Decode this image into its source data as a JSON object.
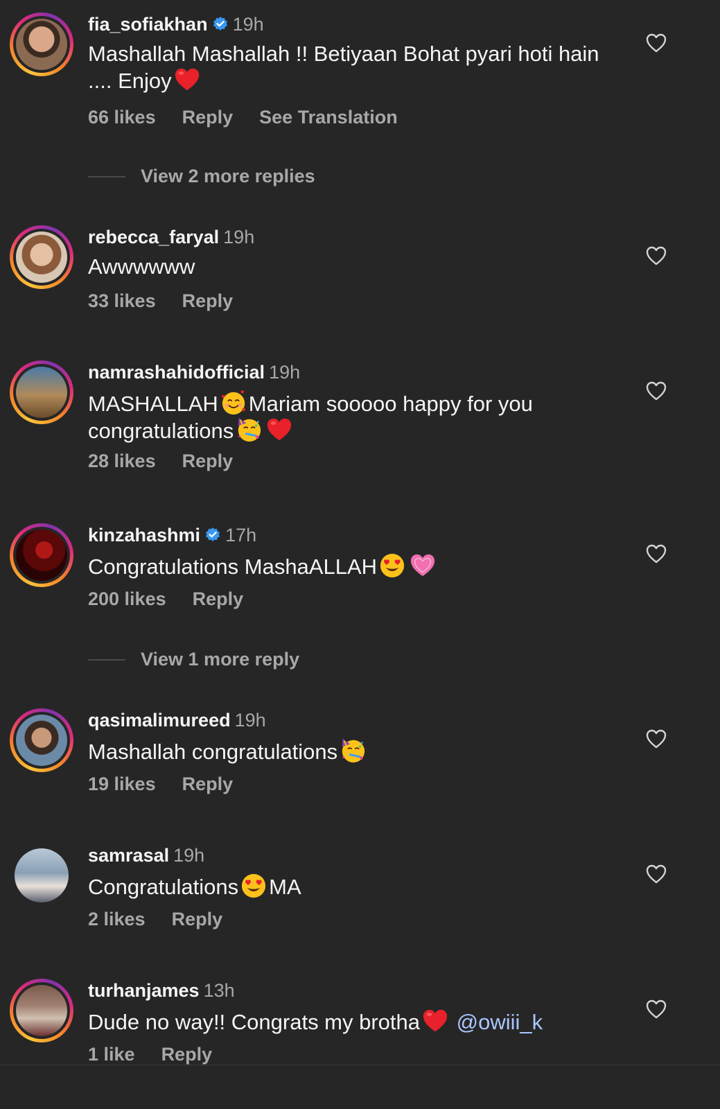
{
  "colors": {
    "background": "#262626",
    "text": "#f5f5f5",
    "muted": "#a8a8a8",
    "verified": "#3897f0",
    "mention": "#a9c7ff"
  },
  "comments": [
    {
      "username": "fia_sofiakhan",
      "verified": true,
      "time": "19h",
      "text": "Mashallah Mashallah !! Betiyaan Bohat pyari hoti hain .... Enjoy",
      "emojis": [
        "red-heart"
      ],
      "likes": "66 likes",
      "reply": "Reply",
      "translate": "See Translation"
    },
    {
      "username": "rebecca_faryal",
      "verified": false,
      "time": "19h",
      "text": "Awwwwww",
      "likes": "33 likes",
      "reply": "Reply"
    },
    {
      "username": "namrashahidofficial",
      "verified": false,
      "time": "19h",
      "text_part1": "MASHALLAH",
      "text_part2": "Mariam sooooo happy for you congratulations",
      "emojis": [
        "smiling-face-with-hearts",
        "partying-face",
        "red-heart"
      ],
      "likes": "28 likes",
      "reply": "Reply"
    },
    {
      "username": "kinzahashmi",
      "verified": true,
      "time": "17h",
      "text": "Congratulations MashaALLAH",
      "emojis": [
        "heart-eyes",
        "pink-heart"
      ],
      "likes": "200 likes",
      "reply": "Reply"
    },
    {
      "username": "qasimalimureed",
      "verified": false,
      "time": "19h",
      "text": "Mashallah congratulations",
      "emojis": [
        "partying-face"
      ],
      "likes": "19 likes",
      "reply": "Reply"
    },
    {
      "username": "samrasal",
      "verified": false,
      "time": "19h",
      "text_part1": "Congratulations",
      "text_part2": "MA",
      "emojis": [
        "heart-eyes"
      ],
      "likes": "2 likes",
      "reply": "Reply"
    },
    {
      "username": "turhanjames",
      "verified": false,
      "time": "13h",
      "text": "Dude no way!! Congrats my brotha",
      "mention": "@owiii_k",
      "emojis": [
        "red-heart"
      ],
      "likes": "1 like",
      "reply": "Reply"
    }
  ],
  "view_more": [
    "View 2 more replies",
    "View 1 more reply"
  ]
}
